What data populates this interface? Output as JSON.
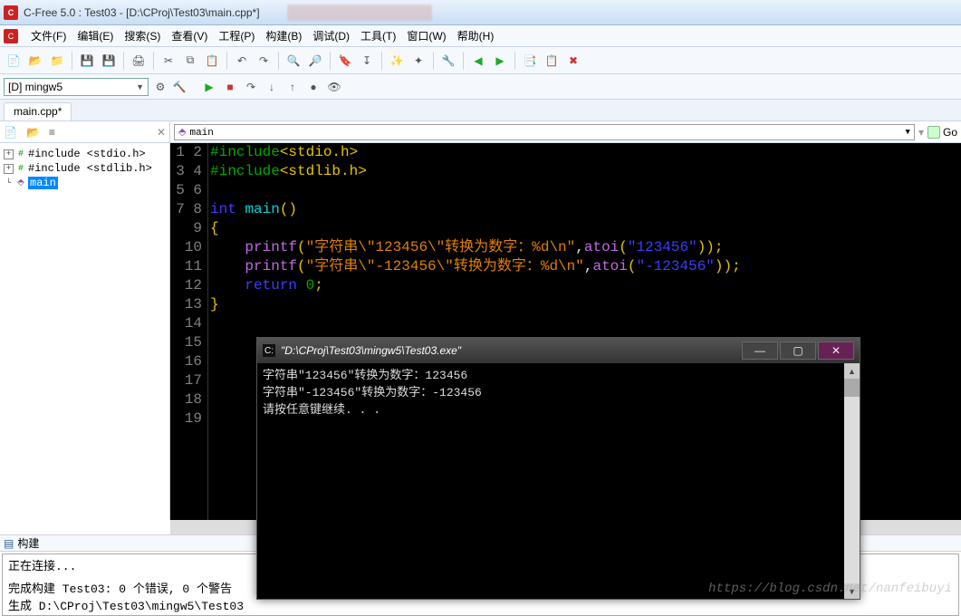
{
  "title": "C-Free 5.0 : Test03 - [D:\\CProj\\Test03\\main.cpp*]",
  "menu": [
    "文件(F)",
    "编辑(E)",
    "搜索(S)",
    "查看(V)",
    "工程(P)",
    "构建(B)",
    "调试(D)",
    "工具(T)",
    "窗口(W)",
    "帮助(H)"
  ],
  "compiler": "[D] mingw5",
  "tab": "main.cpp*",
  "func_combo": "main",
  "go_label": "Go",
  "tree": {
    "inc1": "#include <stdio.h>",
    "inc2": "#include <stdlib.h>",
    "main": "main"
  },
  "gutter_lines": [
    "1",
    "2",
    "3",
    "4",
    "5",
    "6",
    "7",
    "8",
    "9",
    "10",
    "11",
    "12",
    "13",
    "14",
    "15",
    "16",
    "17",
    "18",
    "19"
  ],
  "code": {
    "l1a": "#include",
    "l1b": "<stdio.h>",
    "l2a": "#include",
    "l2b": "<stdlib.h>",
    "l4_int": "int",
    "l4_main": "main",
    "l4_par": "()",
    "l5": "{",
    "l6_printf": "printf",
    "l6_p1": "(",
    "l6_s": "\"字符串\\\"123456\\\"转换为数字：%d\\n\"",
    "l6_c": ",",
    "l6_atoi": "atoi",
    "l6_p2": "(",
    "l6_s2": "\"123456\"",
    "l6_p3": "));",
    "l7_printf": "printf",
    "l7_p1": "(",
    "l7_s": "\"字符串\\\"-123456\\\"转换为数字：%d\\n\"",
    "l7_c": ",",
    "l7_atoi": "atoi",
    "l7_p2": "(",
    "l7_s2": "\"-123456\"",
    "l7_p3": "));",
    "l8_ret": "return",
    "l8_sp": " ",
    "l8_0": "0",
    "l8_semi": ";",
    "l9": "}"
  },
  "console": {
    "title": "\"D:\\CProj\\Test03\\mingw5\\Test03.exe\"",
    "line1": "字符串\"123456\"转换为数字：123456",
    "line2": "字符串\"-123456\"转换为数字：-123456",
    "line3": "请按任意键继续. . ."
  },
  "build": {
    "header": "构建",
    "l1": "正在连接...",
    "l2": "完成构建 Test03: 0 个错误, 0 个警告",
    "l3": "生成 D:\\CProj\\Test03\\mingw5\\Test03"
  },
  "watermark": "https://blog.csdn.net/nanfeibuyi"
}
